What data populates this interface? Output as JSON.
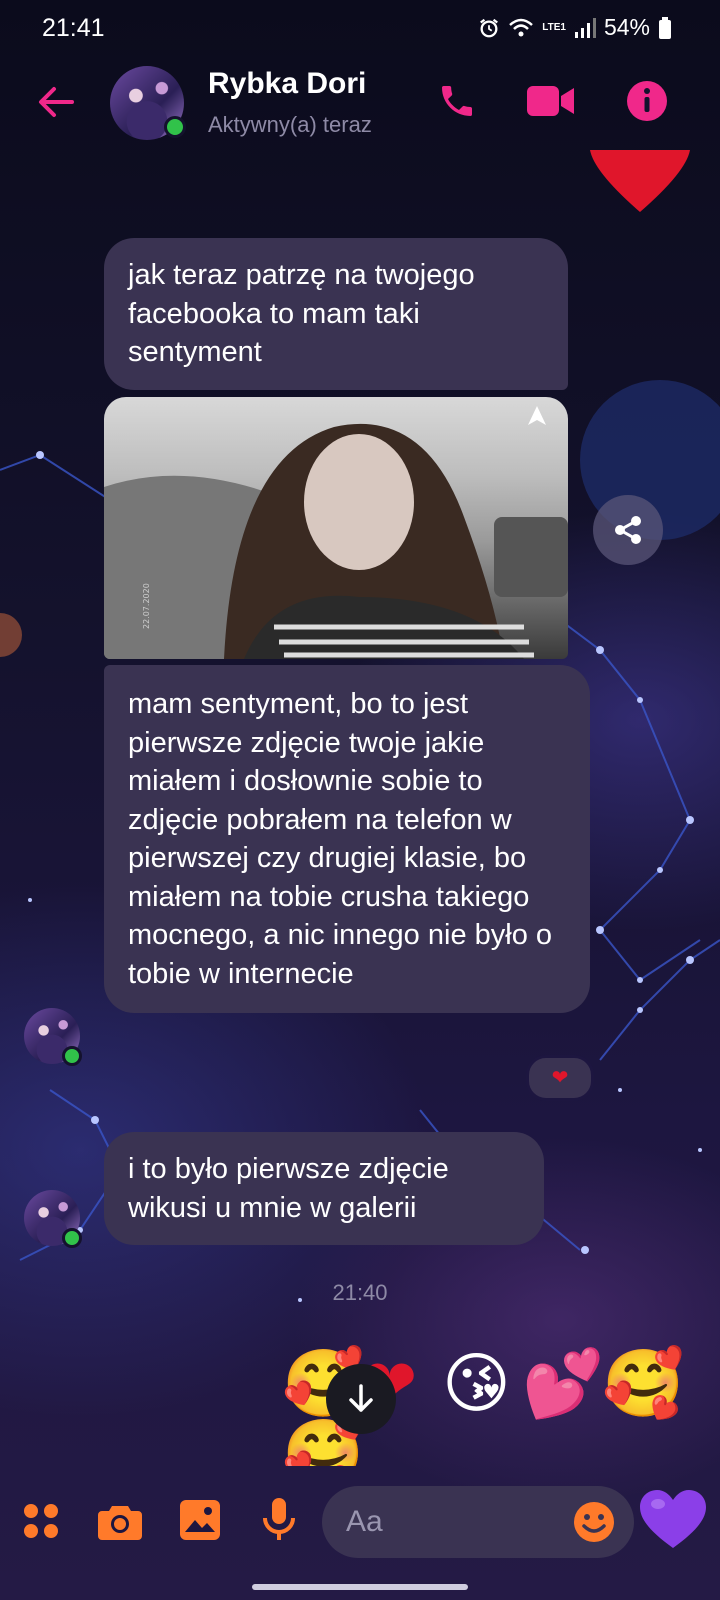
{
  "status_bar": {
    "time": "21:41",
    "network": "LTE1",
    "battery": "54%"
  },
  "header": {
    "name": "Rybka Dori",
    "status": "Aktywny(a) teraz"
  },
  "messages": [
    "jak teraz patrzę na twojego facebooka to mam taki sentyment",
    "mam sentyment, bo to jest pierwsze zdjęcie twoje jakie miałem i dosłownie sobie to zdjęcie pobrałem na telefon w pierwszej czy drugiej klasie, bo miałem na tobie crusha takiego mocnego, a nic innego nie było o tobie w internecie",
    "i to było pierwsze zdjęcie wikusi u mnie w galerii"
  ],
  "photo_caption": "22.07.2020",
  "reaction": "❤",
  "timestamp": "21:40",
  "emojis": [
    "🥰",
    "❤",
    "😘",
    "💕",
    "🥰",
    "🥰"
  ],
  "composer": {
    "placeholder": "Aa"
  },
  "icons": {
    "header": [
      "back-arrow-icon",
      "phone-icon",
      "video-camera-icon",
      "info-icon"
    ],
    "bottom": [
      "menu-dots-icon",
      "camera-icon",
      "gallery-icon",
      "microphone-icon",
      "smiley-icon",
      "purple-heart-icon"
    ]
  },
  "colors": {
    "accent_pink": "#f0288a",
    "bottom_orange": "#ff7a2a",
    "bubble": "#3a3352",
    "online": "#31c24a",
    "heart_purple": "#8b3fe8"
  }
}
